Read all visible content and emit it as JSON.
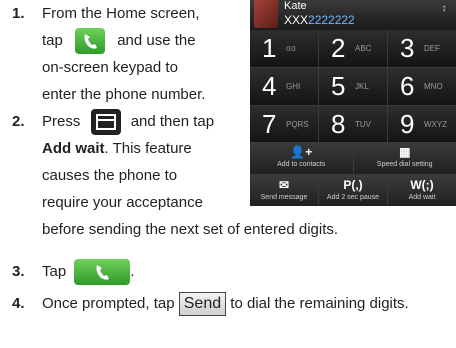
{
  "steps": [
    {
      "num": "1.",
      "l1": "From the Home screen,",
      "l2a": "tap",
      "l2b": "and use the",
      "l3": "on-screen keypad to",
      "l4": "enter the phone number."
    },
    {
      "num": "2.",
      "l1a": "Press",
      "l1b": "and then tap",
      "l2b": "Add wait",
      ". This feature": "",
      "l2c": ". This feature",
      "l3": "causes the phone to",
      "l4": "require your acceptance",
      "l5": "before sending the next set of entered digits."
    },
    {
      "num": "3.",
      "l1": "Tap",
      "l1end": "."
    },
    {
      "num": "4.",
      "l1a": "Once prompted, tap",
      "key": "Send",
      "l1b": "to dial the remaining digits."
    }
  ],
  "phone": {
    "name": "Kate",
    "number_prefix": "XXX",
    "number_highlight": "2222222",
    "keys": [
      {
        "d": "1",
        "l": "σσ"
      },
      {
        "d": "2",
        "l": "ABC"
      },
      {
        "d": "3",
        "l": "DEF"
      },
      {
        "d": "4",
        "l": "GHI"
      },
      {
        "d": "5",
        "l": "JKL"
      },
      {
        "d": "6",
        "l": "MNO"
      },
      {
        "d": "7",
        "l": "PQRS"
      },
      {
        "d": "8",
        "l": "TUV"
      },
      {
        "d": "9",
        "l": "WXYZ"
      }
    ],
    "actions": {
      "add_contacts": "Add to contacts",
      "speed_dial": "Speed dial setting",
      "send_message": "Send message",
      "pause_symbol": "P(,)",
      "pause": "Add 2 sec pause",
      "wait_symbol": "W(;)",
      "wait": "Add wait"
    }
  },
  "icons": {
    "phone": "phone-call-icon",
    "menu": "menu-key-icon",
    "contact": "add-contact-icon",
    "speed": "speed-dial-icon",
    "message": "message-icon"
  }
}
